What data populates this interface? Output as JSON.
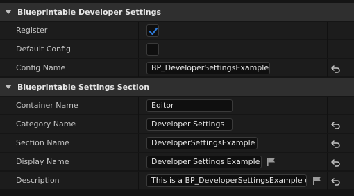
{
  "sections": [
    {
      "title": "Blueprintable Developer Settings"
    },
    {
      "title": "Blueprintable Settings Section"
    }
  ],
  "settings": {
    "register": {
      "label": "Register",
      "checked": true
    },
    "default_config": {
      "label": "Default Config",
      "checked": false
    },
    "config_name": {
      "label": "Config Name",
      "value": "BP_DeveloperSettingsExample"
    }
  },
  "section_props": {
    "container_name": {
      "label": "Container Name",
      "value": "Editor"
    },
    "category_name": {
      "label": "Category Name",
      "value": "Developer Settings"
    },
    "section_name": {
      "label": "Section Name",
      "value": "DeveloperSettingsExample"
    },
    "display_name": {
      "label": "Display Name",
      "value": "Developer Settings Example"
    },
    "description": {
      "label": "Description",
      "value": "This is a BP_DeveloperSettingsExample c"
    }
  },
  "colors": {
    "accent_check": "#2f7bd9",
    "panel_bg": "#1c1c1c",
    "header_bg": "#2f2f2f"
  }
}
